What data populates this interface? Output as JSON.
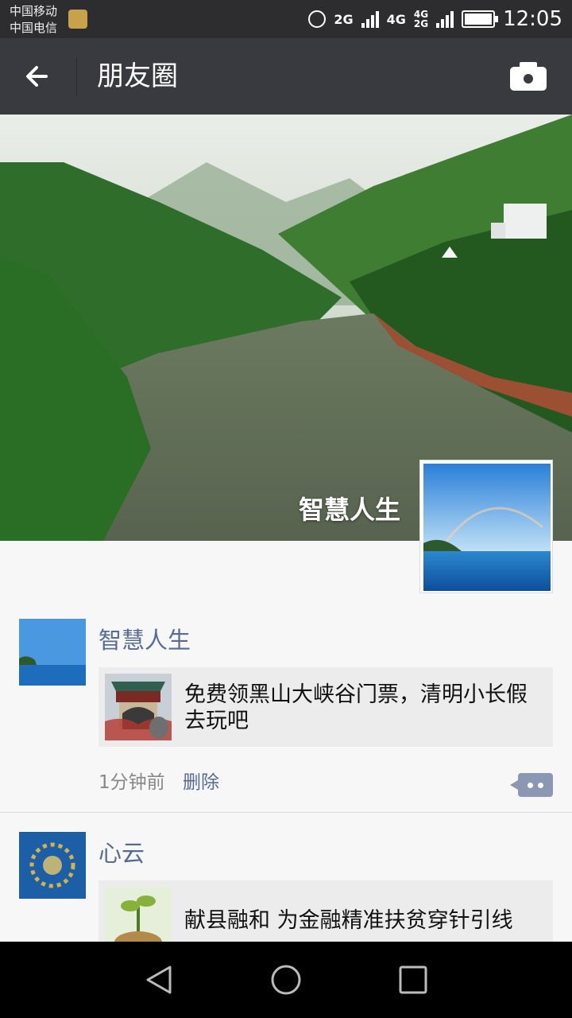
{
  "status_bar": {
    "carrier_1": "中国移动",
    "carrier_2": "中国电信",
    "net_1": "2G",
    "net_2": "4G",
    "net_3": "4G",
    "net_4": "2G",
    "time": "12:05"
  },
  "nav": {
    "title": "朋友圈",
    "back_icon": "arrow-left-icon",
    "camera_icon": "camera-icon"
  },
  "cover": {
    "name": "智慧人生"
  },
  "posts": [
    {
      "author": "智慧人生",
      "link_title": "免费领黑山大峡谷门票，清明小长假去玩吧",
      "time": "1分钟前",
      "delete_label": "删除"
    },
    {
      "author": "心云",
      "link_title": "献县融和  为金融精准扶贫穿针引线"
    }
  ],
  "colors": {
    "nav_bg": "#393a3f",
    "link_blue": "#576b95"
  }
}
